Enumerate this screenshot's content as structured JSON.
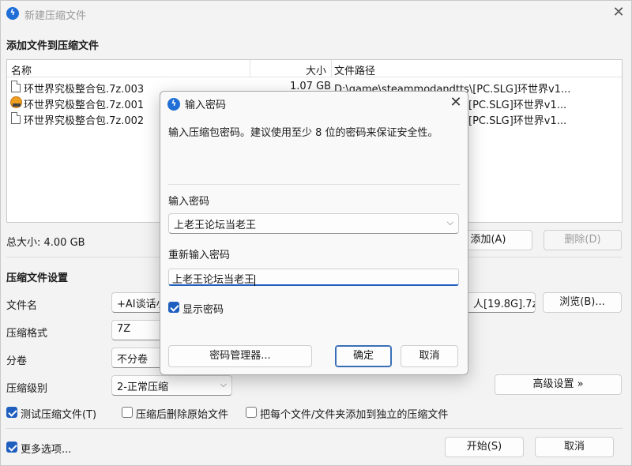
{
  "window": {
    "title": "新建压缩文件",
    "app_icon": "lightning-icon",
    "close_glyph": "✕"
  },
  "add_section": {
    "title": "添加文件到压缩文件",
    "columns": {
      "name": "名称",
      "size": "大小",
      "path": "文件路径"
    },
    "files": [
      {
        "name": "环世界究极整合包.7z.003",
        "size": "1.07 GB",
        "path": "D:\\game\\steammodandtts\\[PC.SLG]环世界v1...",
        "icon": "document-icon"
      },
      {
        "name": "环世界究极整合包.7z.001",
        "size": "",
        "path": "[PC.SLG]环世界v1...",
        "icon": "archive-icon"
      },
      {
        "name": "环世界究极整合包.7z.002",
        "size": "",
        "path": "[PC.SLG]环世界v1...",
        "icon": "document-icon"
      }
    ],
    "total_size": "总大小: 4.00 GB",
    "add_button": "添加(A)",
    "delete_button": "删除(D)"
  },
  "settings": {
    "title": "压缩文件设置",
    "filename_label": "文件名",
    "filename_value": "+AI谈话小",
    "filename_tail": "人[19.8G].7z",
    "browse_button": "浏览(B)...",
    "format_label": "压缩格式",
    "format_value": "7Z",
    "split_label": "分卷",
    "split_value": "不分卷",
    "level_label": "压缩级别",
    "level_value": "2-正常压缩",
    "advanced_button": "高级设置 »",
    "options": [
      {
        "label": "测试压缩文件(T)",
        "checked": true
      },
      {
        "label": "压缩后删除原始文件",
        "checked": false
      },
      {
        "label": "把每个文件/文件夹添加到独立的压缩文件",
        "checked": false
      }
    ]
  },
  "footer": {
    "more_options": "更多选项...",
    "more_checked": true,
    "start_button": "开始(S)",
    "cancel_button": "取消"
  },
  "dialog": {
    "title": "输入密码",
    "close_glyph": "✕",
    "message": "输入压缩包密码。建议使用至少 8 位的密码来保证安全性。",
    "password_label": "输入密码",
    "password_value": "上老王论坛当老王",
    "confirm_label": "重新输入密码",
    "confirm_value": "上老王论坛当老王",
    "show_password": "显示密码",
    "show_password_checked": true,
    "manager_button": "密码管理器...",
    "ok_button": "确定",
    "cancel_button": "取消"
  },
  "colors": {
    "accent": "#1f5fbf",
    "app_icon_blue": "#1f6fd6"
  }
}
